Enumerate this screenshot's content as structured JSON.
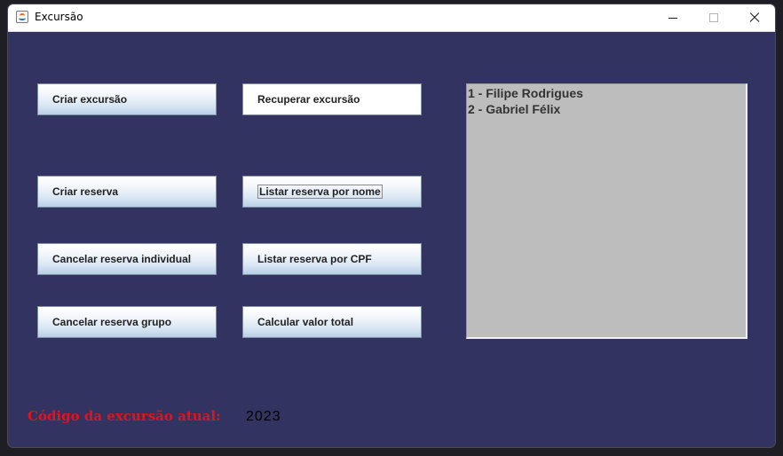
{
  "window": {
    "title": "Excursão",
    "icon": "java-coffee-cup-icon",
    "controls": [
      "minimize-icon",
      "maximize-icon",
      "close-icon"
    ]
  },
  "buttons": {
    "criar_excursao": "Criar excursão",
    "recuperar_excursao": "Recuperar excursão",
    "criar_reserva": "Criar reserva",
    "listar_reserva_nome": "Listar reserva por nome",
    "cancelar_reserva_individual": "Cancelar reserva individual",
    "listar_reserva_cpf": "Listar reserva por CPF",
    "cancelar_reserva_grupo": "Cancelar reserva grupo",
    "calcular_valor_total": "Calcular valor total"
  },
  "output": {
    "lines": [
      "1 - Filipe Rodrigues",
      "2 - Gabriel Félix"
    ]
  },
  "footer": {
    "label": "Código da excursão atual:",
    "value": "2023"
  },
  "colors": {
    "background": "#333362",
    "label_red": "#e0141d",
    "output_bg": "#bdbdbd"
  }
}
